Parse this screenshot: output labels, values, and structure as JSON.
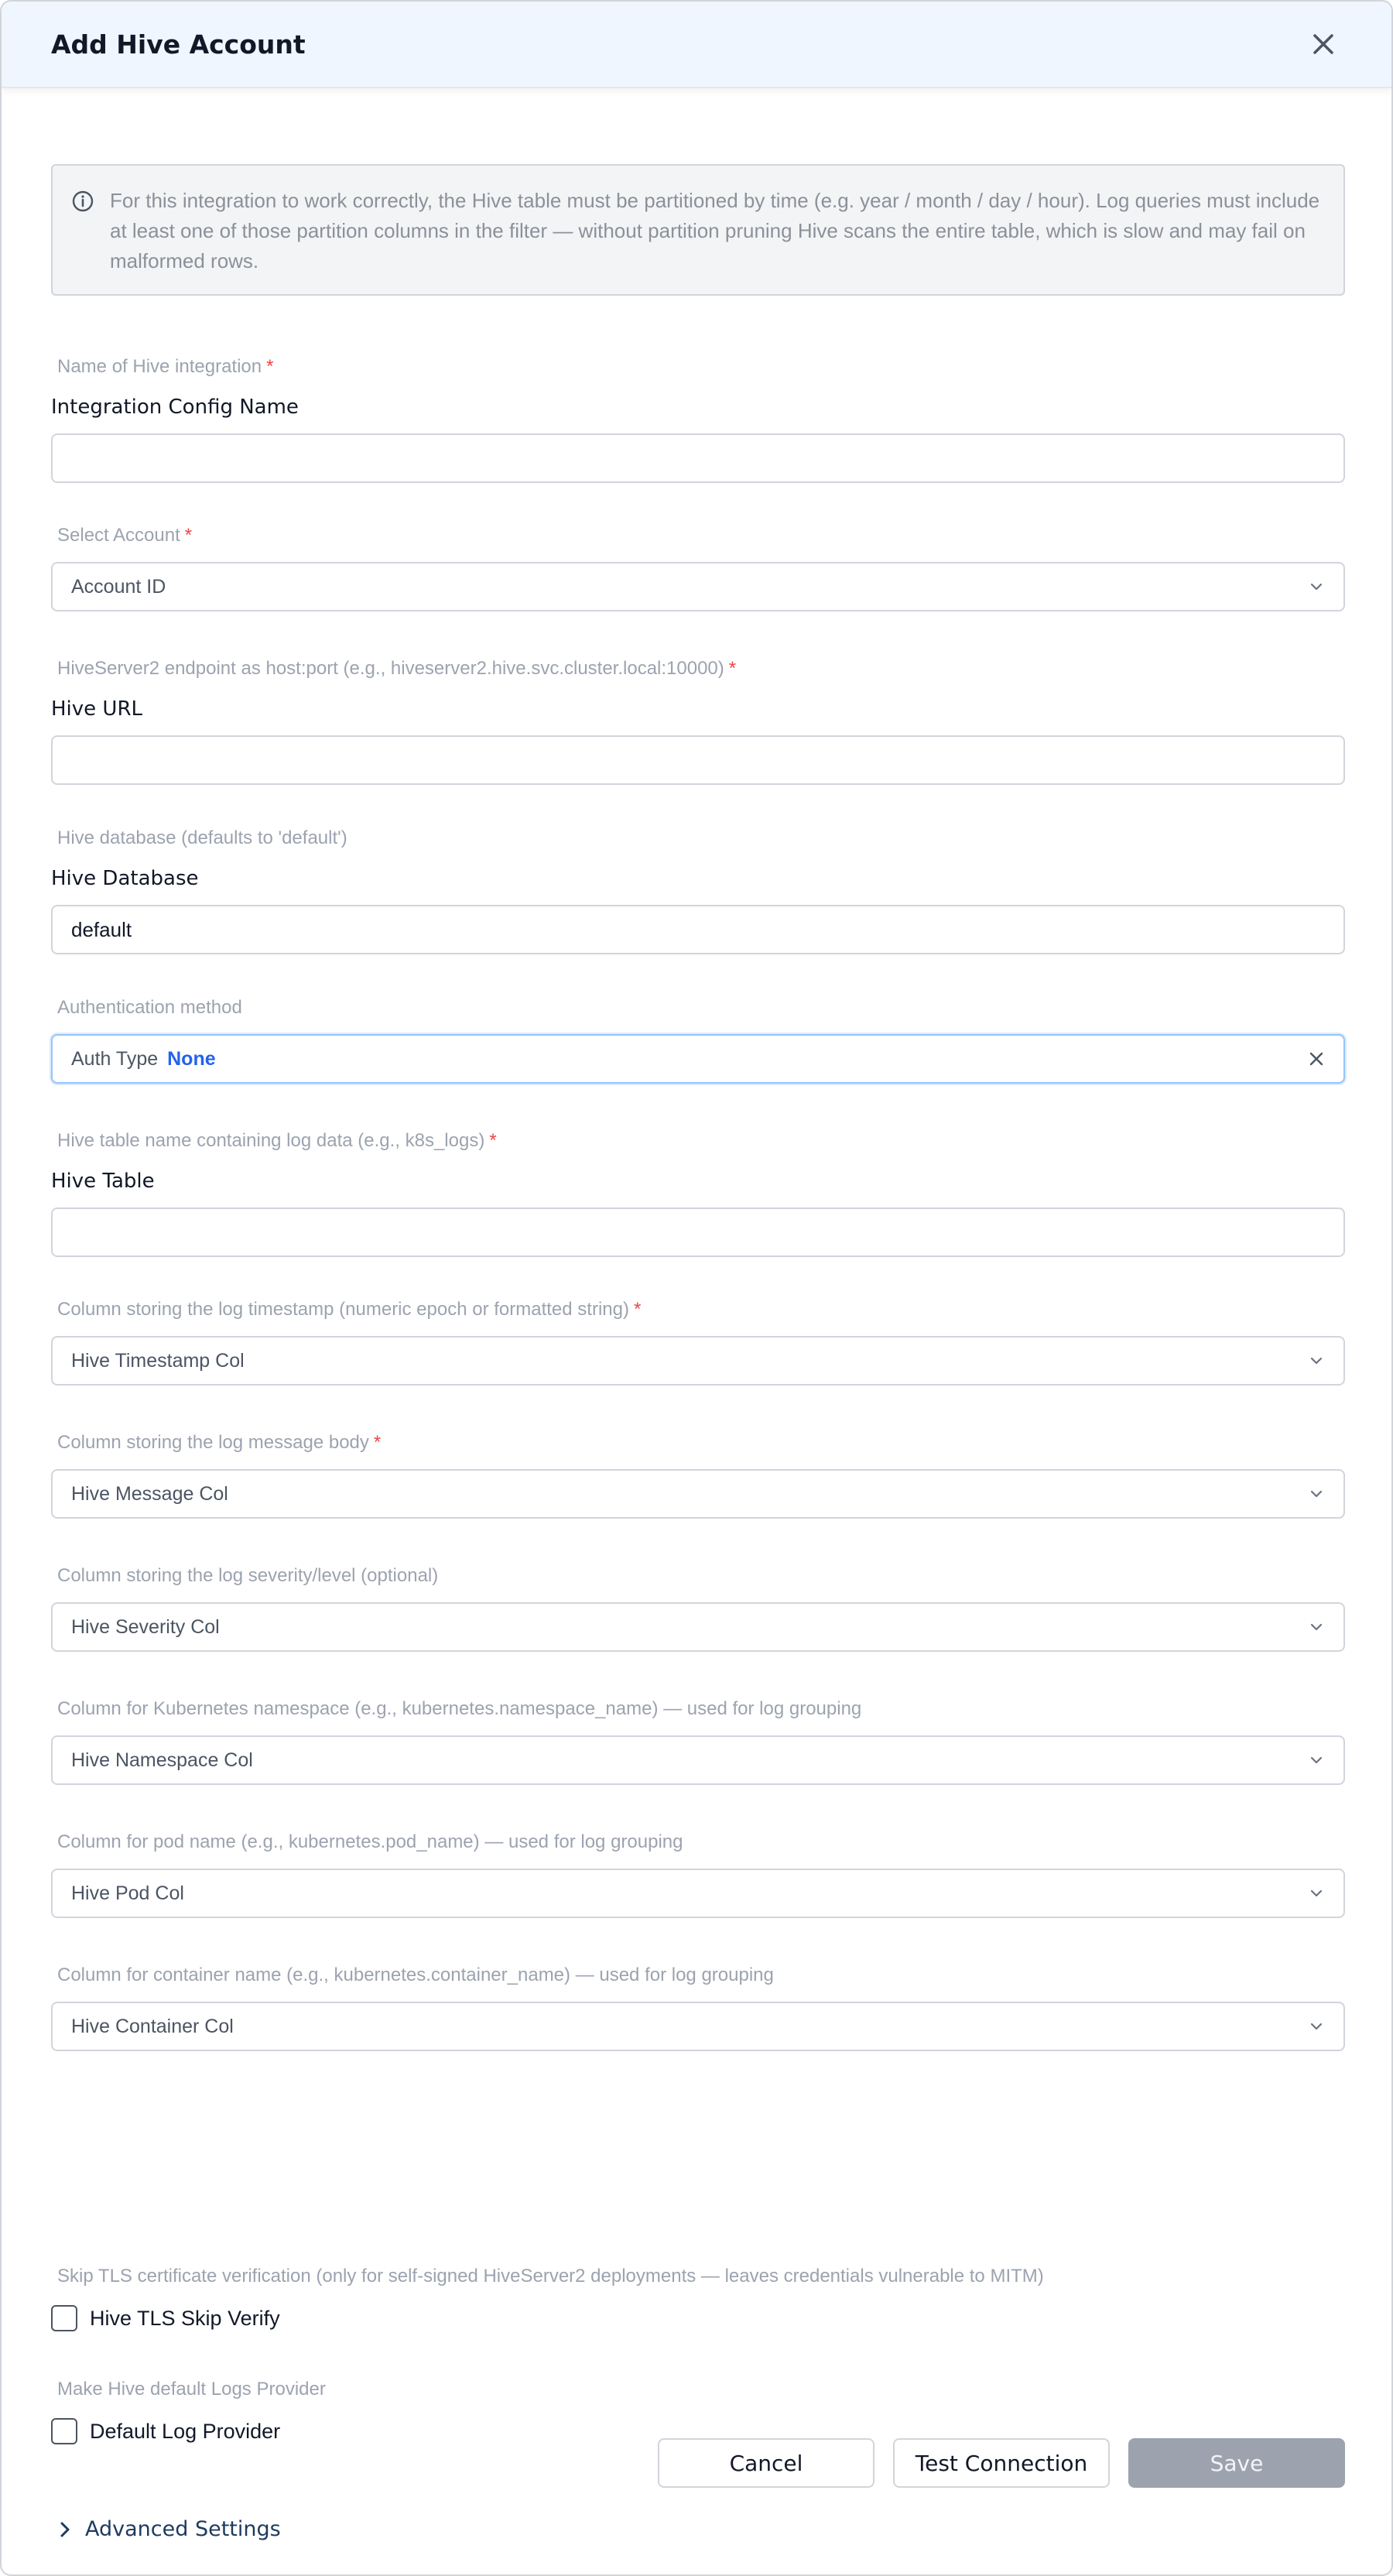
{
  "header": {
    "title": "Add Hive Account"
  },
  "info": {
    "text": "For this integration to work correctly, the Hive table must be partitioned by time (e.g. year / month / day / hour). Log queries must include at least one of those partition columns in the filter — without partition pruning Hive scans the entire table, which is slow and may fail on malformed rows."
  },
  "fields": {
    "config_name": {
      "hint": "Name of Hive integration",
      "label": "Integration Config Name",
      "value": ""
    },
    "account": {
      "hint": "Select Account",
      "placeholder": "Account ID"
    },
    "hive_url": {
      "hint": "HiveServer2 endpoint as host:port (e.g., hiveserver2.hive.svc.cluster.local:10000)",
      "label": "Hive URL",
      "value": ""
    },
    "hive_database": {
      "hint": "Hive database (defaults to 'default')",
      "label": "Hive Database",
      "value": "default"
    },
    "auth": {
      "hint": "Authentication method",
      "label": "Auth Type",
      "value": "None"
    },
    "hive_table": {
      "hint": "Hive table name containing log data (e.g., k8s_logs)",
      "label": "Hive Table",
      "value": ""
    },
    "timestamp_col": {
      "hint": "Column storing the log timestamp (numeric epoch or formatted string)",
      "placeholder": "Hive Timestamp Col"
    },
    "message_col": {
      "hint": "Column storing the log message body",
      "placeholder": "Hive Message Col"
    },
    "severity_col": {
      "hint": "Column storing the log severity/level (optional)",
      "placeholder": "Hive Severity Col"
    },
    "namespace_col": {
      "hint": "Column for Kubernetes namespace (e.g., kubernetes.namespace_name) — used for log grouping",
      "placeholder": "Hive Namespace Col"
    },
    "pod_col": {
      "hint": "Column for pod name (e.g., kubernetes.pod_name) — used for log grouping",
      "placeholder": "Hive Pod Col"
    },
    "container_col": {
      "hint": "Column for container name (e.g., kubernetes.container_name) — used for log grouping",
      "placeholder": "Hive Container Col"
    },
    "tls_skip": {
      "hint": "Skip TLS certificate verification (only for self-signed HiveServer2 deployments — leaves credentials vulnerable to MITM)",
      "label": "Hive TLS Skip Verify",
      "checked": false
    },
    "default_provider": {
      "hint": "Make Hive default Logs Provider",
      "label": "Default Log Provider",
      "checked": false
    }
  },
  "required_mark": "*",
  "advanced": {
    "label": "Advanced Settings"
  },
  "footer": {
    "cancel": "Cancel",
    "test": "Test Connection",
    "save": "Save"
  },
  "colors": {
    "header_bg": "#eff6ff",
    "accent": "#2563eb",
    "required": "#ef4444",
    "save_disabled": "#9ca3af"
  }
}
